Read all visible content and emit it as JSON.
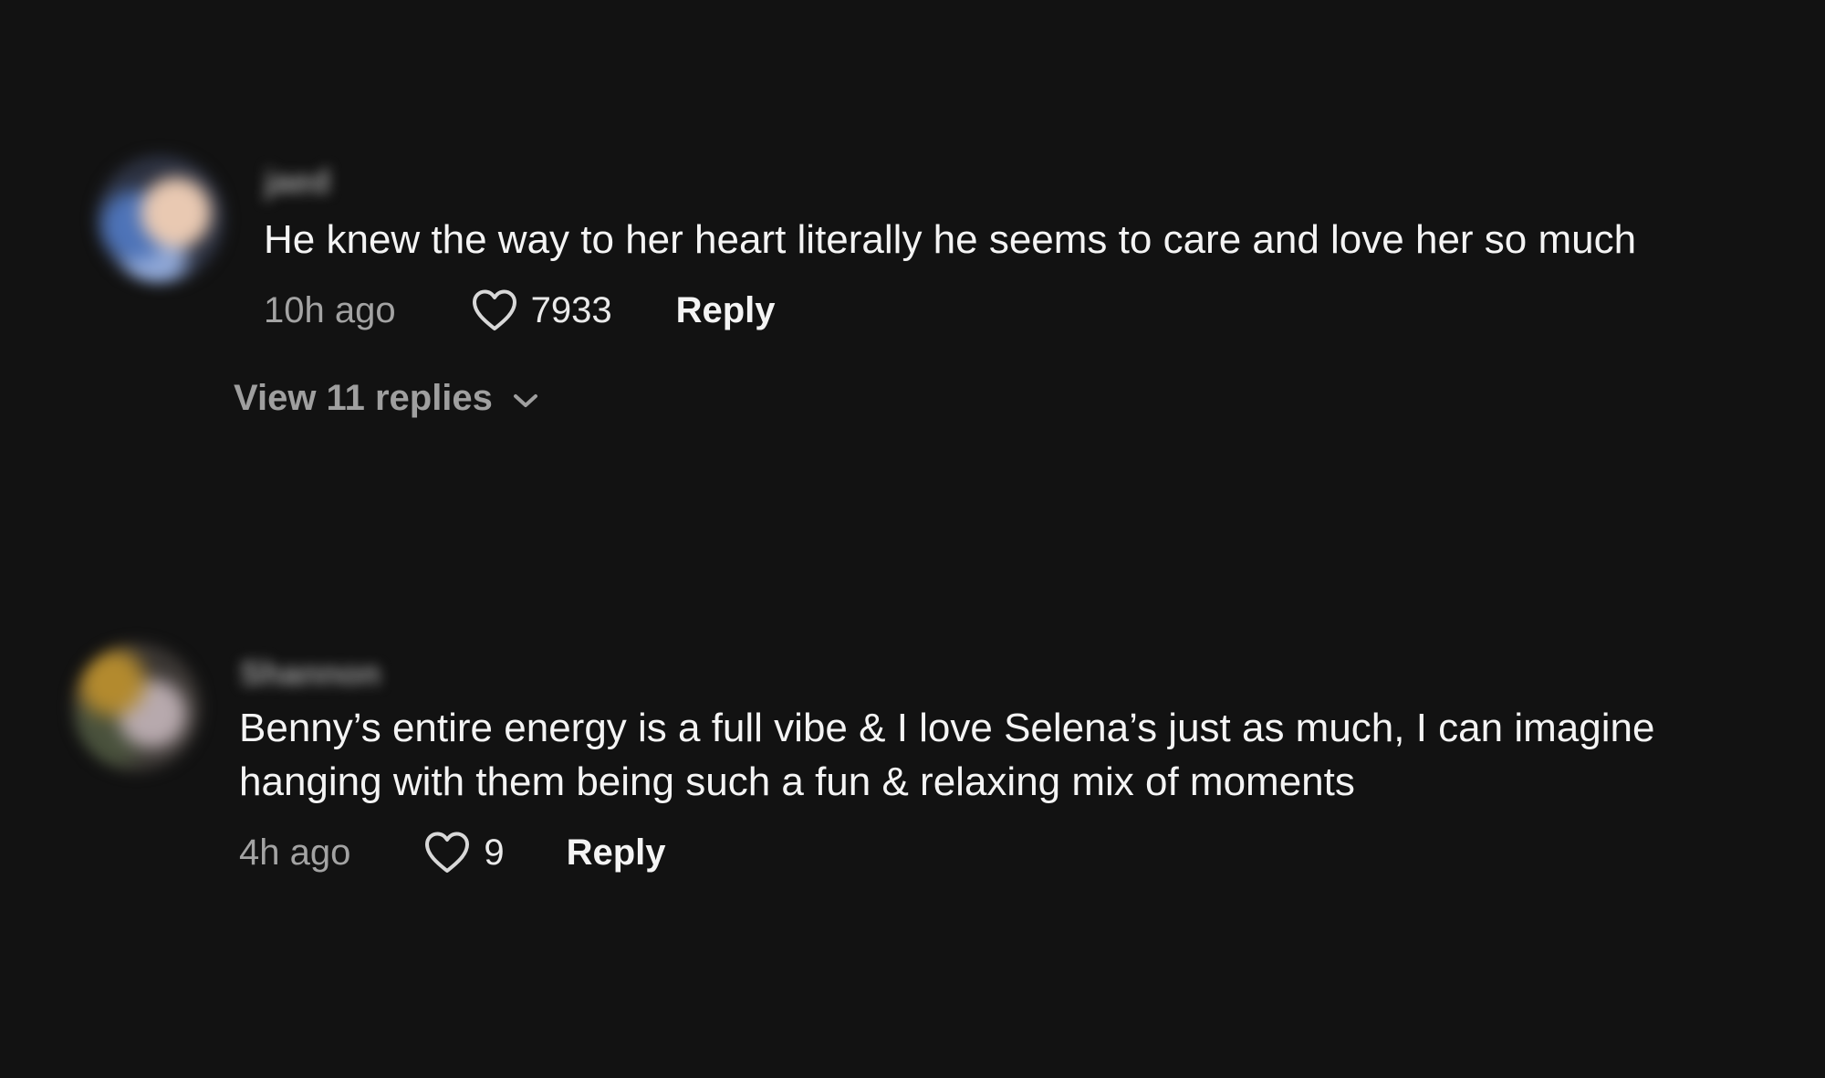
{
  "comments": [
    {
      "username": "jaed",
      "text": "He knew the way to her heart literally he seems to care and love her so much",
      "time": "10h ago",
      "likes": "7933",
      "reply_label": "Reply",
      "view_replies_label": "View 11 replies"
    },
    {
      "username": "Shannon",
      "text": "Benny’s entire energy is a full vibe & I love Selena’s just as much, I can imagine hanging with them being such a fun & relaxing mix of moments",
      "time": "4h ago",
      "likes": "9",
      "reply_label": "Reply"
    }
  ],
  "icons": {
    "like": "heart-outline-icon",
    "expand": "chevron-down-icon"
  },
  "colors": {
    "background": "#121212",
    "primary_text": "#f4f4f4",
    "secondary_text": "#a3a3a3"
  }
}
